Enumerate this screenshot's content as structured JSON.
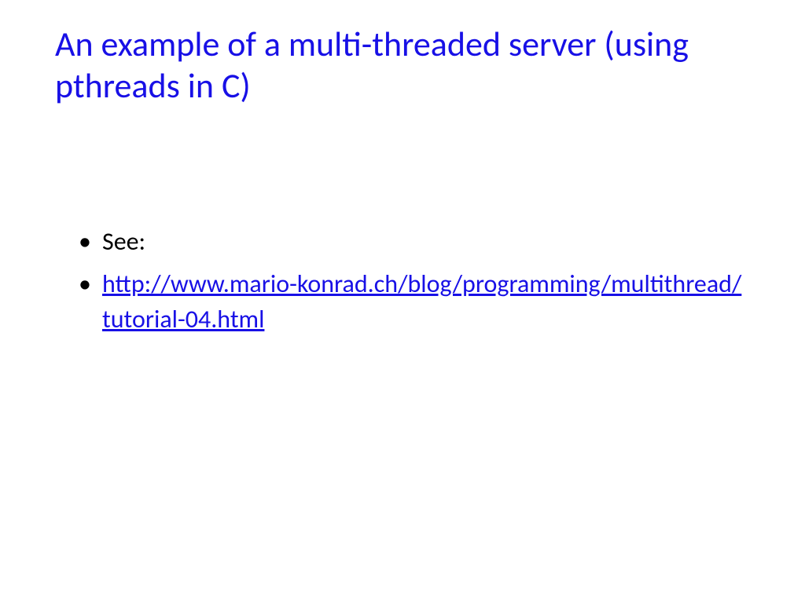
{
  "slide": {
    "title": "An example of a multi-threaded server (using pthreads in C)",
    "bullets": [
      {
        "text": "See:",
        "is_link": false
      },
      {
        "text": "http://www.mario-konrad.ch/blog/programming/multithread/tutorial-04.html",
        "is_link": true
      }
    ]
  }
}
